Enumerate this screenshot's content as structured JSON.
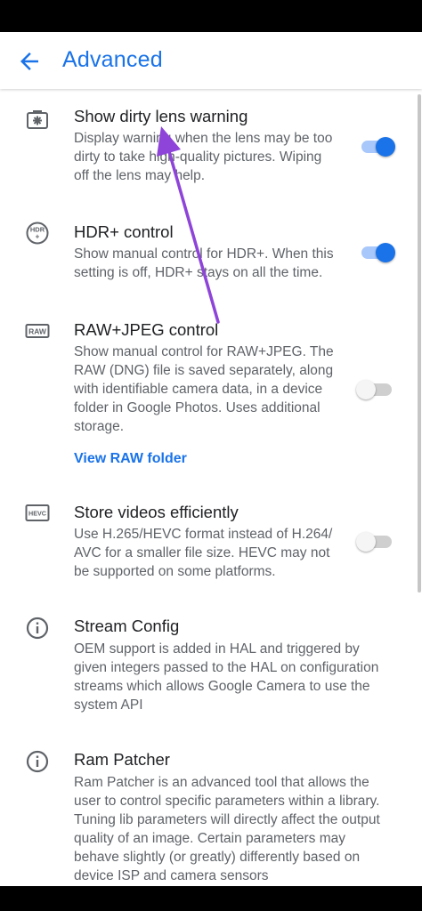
{
  "header": {
    "title": "Advanced",
    "back_icon": "back-arrow-icon"
  },
  "settings": [
    {
      "icon": "dirty-lens-icon",
      "title": "Show dirty lens warning",
      "description_lines": [
        "Display warning when the lens may be too",
        "dirty to take high-quality pictures. Wiping",
        "off the lens may help."
      ],
      "toggle": "on"
    },
    {
      "icon": "hdr-plus-icon",
      "title": "HDR+ control",
      "description_lines": [
        "Show manual control for HDR+. When this",
        "setting is off, HDR+ stays on all the time."
      ],
      "toggle": "on"
    },
    {
      "icon": "raw-icon",
      "title": "RAW+JPEG control",
      "description_lines": [
        "Show manual control for RAW+JPEG. The",
        "RAW (DNG) file is saved separately, along",
        "with identifiable camera data, in a device",
        "folder in Google Photos. Uses additional",
        "storage."
      ],
      "link": "View RAW folder",
      "toggle": "off"
    },
    {
      "icon": "hevc-icon",
      "title": "Store videos efficiently",
      "description_lines": [
        "Use H.265/HEVC format instead of H.264/",
        "AVC for a smaller file size. HEVC may not",
        "be supported on some platforms."
      ],
      "toggle": "off"
    },
    {
      "icon": "info-icon",
      "title": "Stream Config",
      "description_lines": [
        "OEM support is added in HAL and triggered by",
        "given integers passed to the HAL on configuration",
        "streams which allows Google Camera to use the",
        "system API"
      ]
    },
    {
      "icon": "info-icon",
      "title": "Ram Patcher",
      "description_lines": [
        "Ram Patcher is an advanced tool that allows the",
        "user to control specific parameters within a library.",
        "Tuning lib parameters will directly affect the output",
        "quality of an image. Certain parameters may",
        "behave slightly (or greatly) differently based on",
        "device ISP and camera sensors"
      ]
    }
  ],
  "icons": {
    "raw_glyph_text": "RAW",
    "hevc_glyph_text": "HEVC",
    "hdr_glyph_text": "HDR+"
  },
  "colors": {
    "accent": "#1a73e8",
    "annotation_arrow": "#8e44d9"
  }
}
